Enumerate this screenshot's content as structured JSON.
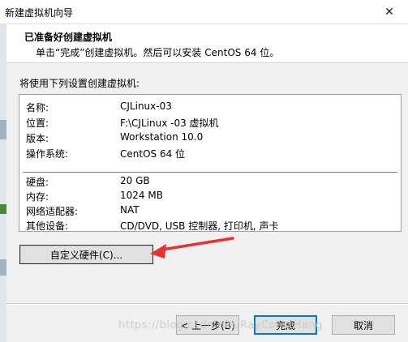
{
  "window": {
    "title": "新建虚拟机向导",
    "close_glyph": "✕"
  },
  "header": {
    "title": "已准备好创建虚拟机",
    "subtitle": "单击“完成”创建虚拟机。然后可以安装 CentOS 64 位。"
  },
  "intro": "将使用下列设置创建虚拟机:",
  "settings": {
    "group1": [
      {
        "key": "名称:",
        "value": "CJLinux-03"
      },
      {
        "key": "位置:",
        "value": "F:\\CJLinux -03 虚拟机"
      },
      {
        "key": "版本:",
        "value": "Workstation 10.0"
      },
      {
        "key": "操作系统:",
        "value": "CentOS 64 位"
      }
    ],
    "group2": [
      {
        "key": "硬盘:",
        "value": "20 GB"
      },
      {
        "key": "内存:",
        "value": "1024 MB"
      },
      {
        "key": "网络适配器:",
        "value": "NAT"
      },
      {
        "key": "其他设备:",
        "value": "CD/DVD, USB 控制器, 打印机, 声卡"
      }
    ]
  },
  "buttons": {
    "customize": "自定义硬件(C)...",
    "back": "< 上一步(B)",
    "finish": "完成",
    "cancel": "取消"
  },
  "annotation_arrow_color": "#e8322f",
  "focus_color": "#0078d7",
  "watermark": "https://blog.csdn.net/RayConstHang"
}
